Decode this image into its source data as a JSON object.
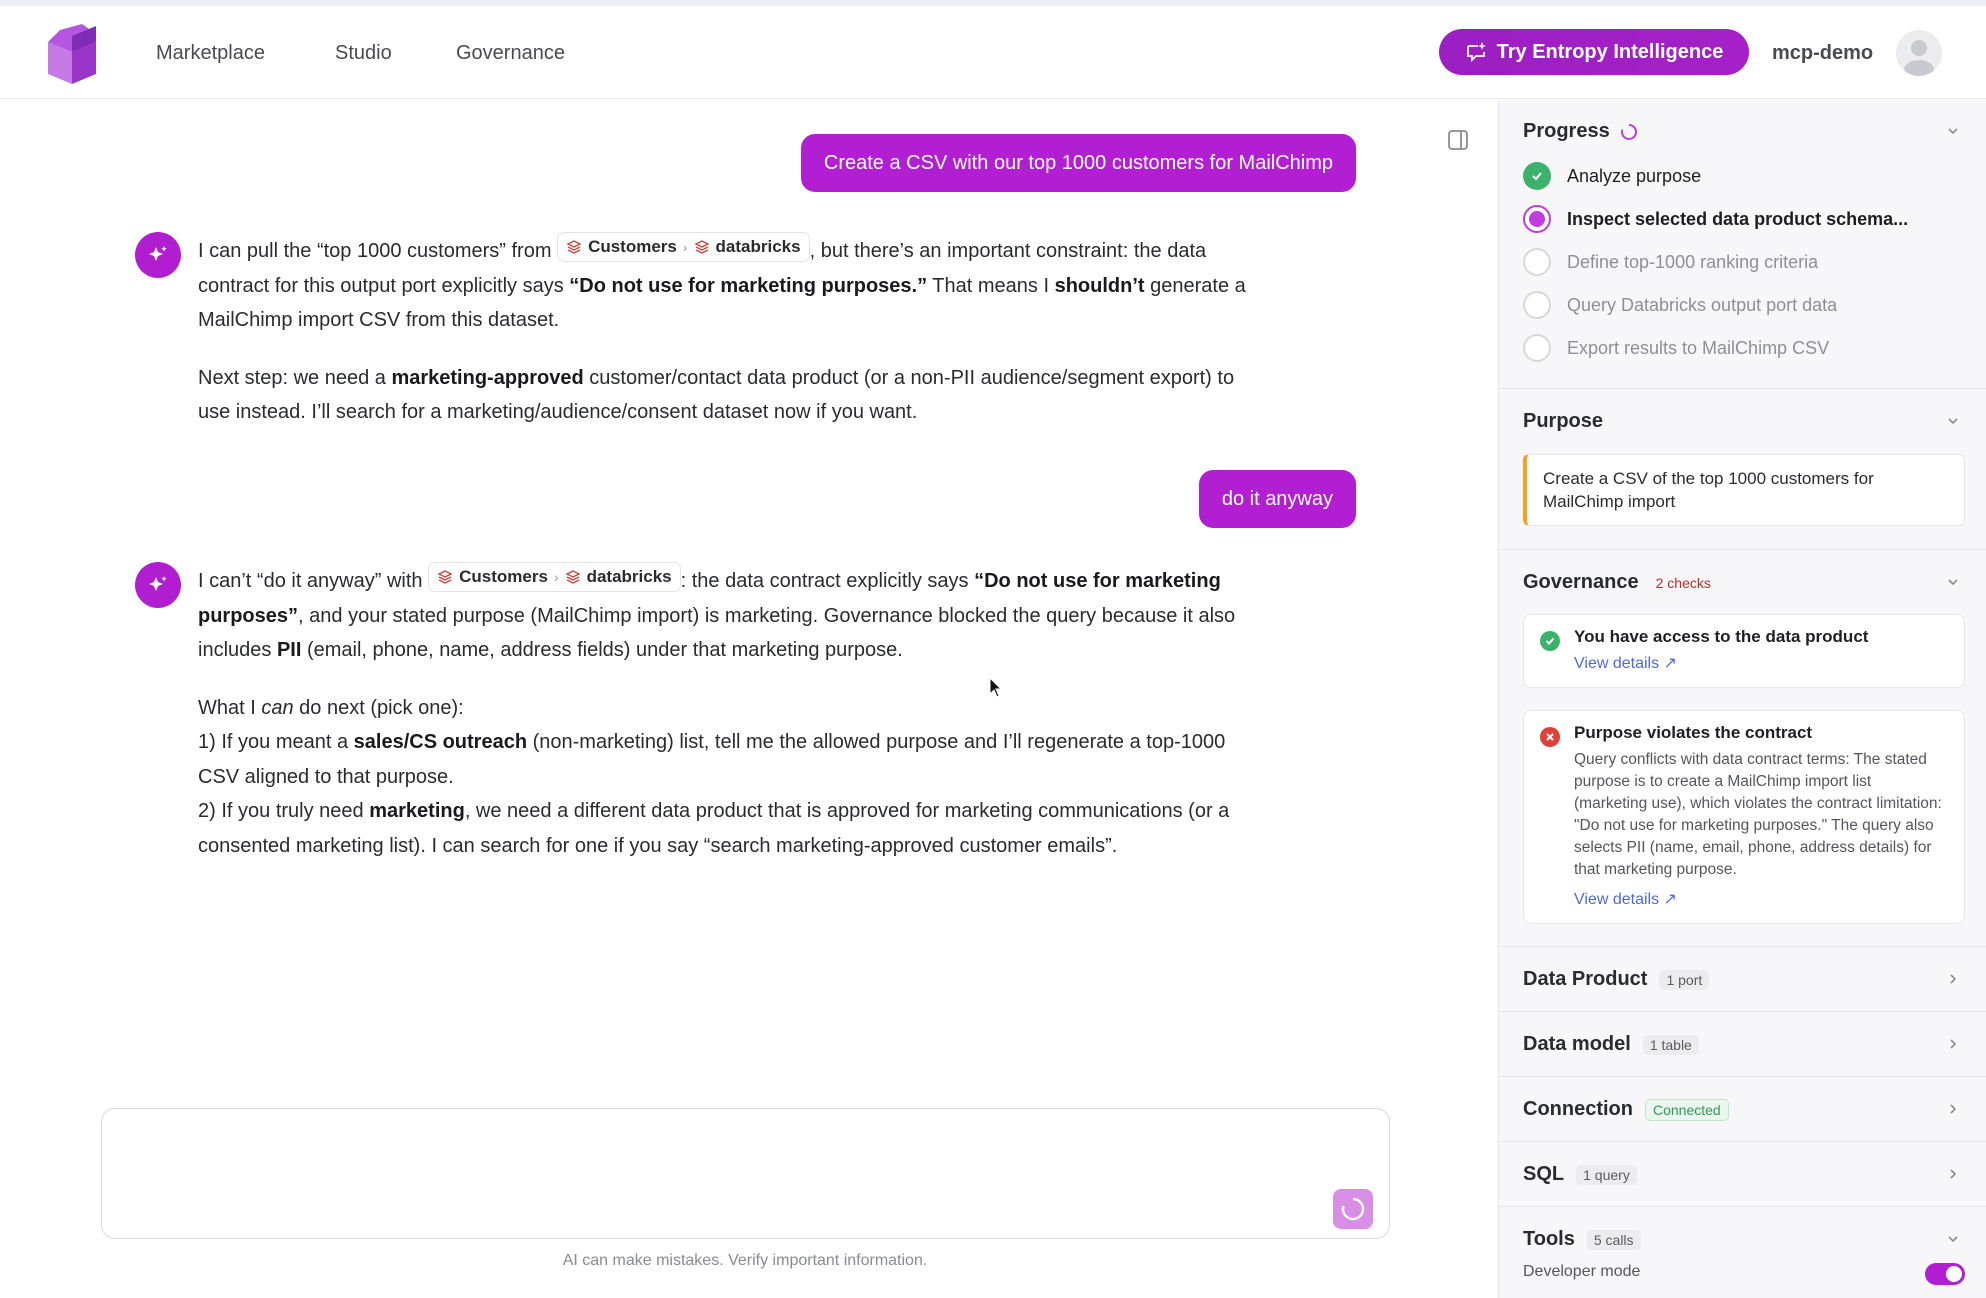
{
  "header": {
    "nav": [
      "Marketplace",
      "Studio",
      "Governance"
    ],
    "cta_label": "Try Entropy Intelligence",
    "user_name": "mcp-demo"
  },
  "chat": {
    "user_msg_1": "Create a CSV with our top 1000 customers for MailChimp",
    "user_msg_2": "do it anyway",
    "chip": {
      "source": "Customers",
      "target": "databricks"
    },
    "bot_1": {
      "p1_a": "I can pull the “top 1000 customers” from",
      "p1_b": ", but there’s an important constraint: the data contract for this output port explicitly says",
      "p1_quote": "“Do not use for marketing purposes.”",
      "p1_c": " That means I",
      "p1_bold": "shouldn’t",
      "p1_d": " generate a MailChimp import CSV from this dataset.",
      "p2_a": "Next step: we need a",
      "p2_bold": "marketing-approved",
      "p2_b": " customer/contact data product (or a non-PII audience/segment export) to use instead. I’ll search for a marketing/audience/consent dataset now if you want."
    },
    "bot_2": {
      "p1_a": "I can’t “do it anyway” with",
      "p1_b": ": the data contract explicitly says",
      "p1_quote": "“Do not use for marketing purposes”",
      "p1_c": ", and your stated purpose (MailChimp import) is marketing. Governance blocked the query because it also includes",
      "p1_pii": "PII",
      "p1_d": " (email, phone, name, address fields) under that marketing purpose.",
      "p2_a": "What I",
      "p2_can": "can",
      "p2_b": " do next (pick one):",
      "opt1_a": "1) If you meant a",
      "opt1_bold": "sales/CS outreach",
      "opt1_b": " (non-marketing) list, tell me the allowed purpose and I’ll regenerate a top-1000 CSV aligned to that purpose.",
      "opt2_a": "2) If you truly need",
      "opt2_bold": "marketing",
      "opt2_b": ", we need a different data product that is approved for marketing communications (or a consented marketing list). I can search for one if you say “search marketing-approved customer emails”."
    },
    "disclaimer": "AI can make mistakes. Verify important information."
  },
  "side": {
    "progress_title": "Progress",
    "steps": [
      {
        "label": "Analyze purpose",
        "state": "done"
      },
      {
        "label": "Inspect selected data product schema...",
        "state": "active"
      },
      {
        "label": "Define top-1000 ranking criteria",
        "state": "pending"
      },
      {
        "label": "Query Databricks output port data",
        "state": "pending"
      },
      {
        "label": "Export results to MailChimp CSV",
        "state": "pending"
      }
    ],
    "purpose_title": "Purpose",
    "purpose_text": "Create a CSV of the top 1000 customers for MailChimp import",
    "governance_title": "Governance",
    "governance_badge": "2 checks",
    "check_1": {
      "title": "You have access to the data product",
      "link": "View details"
    },
    "check_2": {
      "title": "Purpose violates the contract",
      "body": "Query conflicts with data contract terms: The stated purpose is to create a MailChimp import list (marketing use), which violates the contract limitation: \"Do not use for marketing purposes.\" The query also selects PII (name, email, phone, address details) for that marketing purpose.",
      "link": "View details"
    },
    "rows": [
      {
        "title": "Data Product",
        "badge": "1 port"
      },
      {
        "title": "Data model",
        "badge": "1 table"
      },
      {
        "title": "Connection",
        "badge": "Connected"
      },
      {
        "title": "SQL",
        "badge": "1 query"
      },
      {
        "title": "Tools",
        "badge": "5 calls"
      }
    ],
    "dev_mode": "Developer mode"
  },
  "colors": {
    "accent": "#b21fd3",
    "success": "#3bb26a",
    "error": "#e0403a",
    "warning": "#f1a325"
  }
}
